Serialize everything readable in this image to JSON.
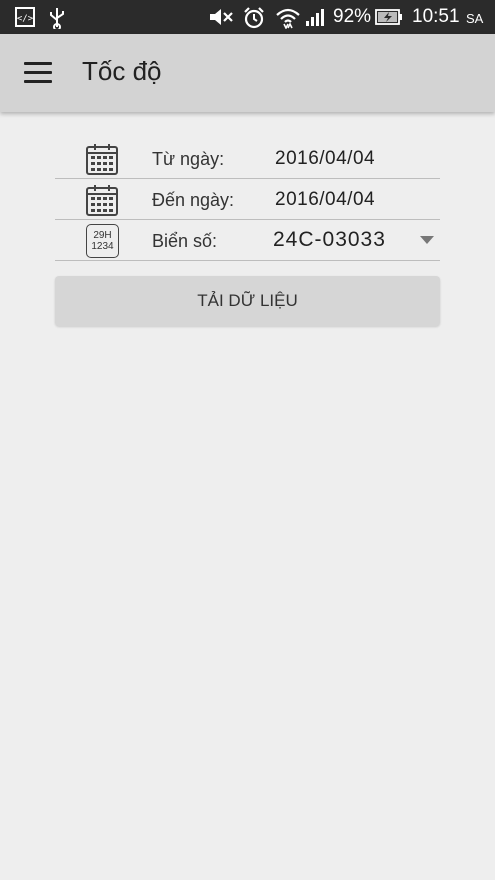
{
  "status_bar": {
    "battery": "92%",
    "time": "10:51",
    "ampm": "SA"
  },
  "app_bar": {
    "title": "Tốc độ"
  },
  "form": {
    "from_date": {
      "label": "Từ ngày:",
      "value": "2016/04/04"
    },
    "to_date": {
      "label": "Đến ngày:",
      "value": "2016/04/04"
    },
    "plate": {
      "label": "Biển số:",
      "value": "24C-03033",
      "icon_line1": "29H",
      "icon_line2": "1234"
    }
  },
  "load_button": {
    "label": "TẢI DỮ LIỆU"
  }
}
